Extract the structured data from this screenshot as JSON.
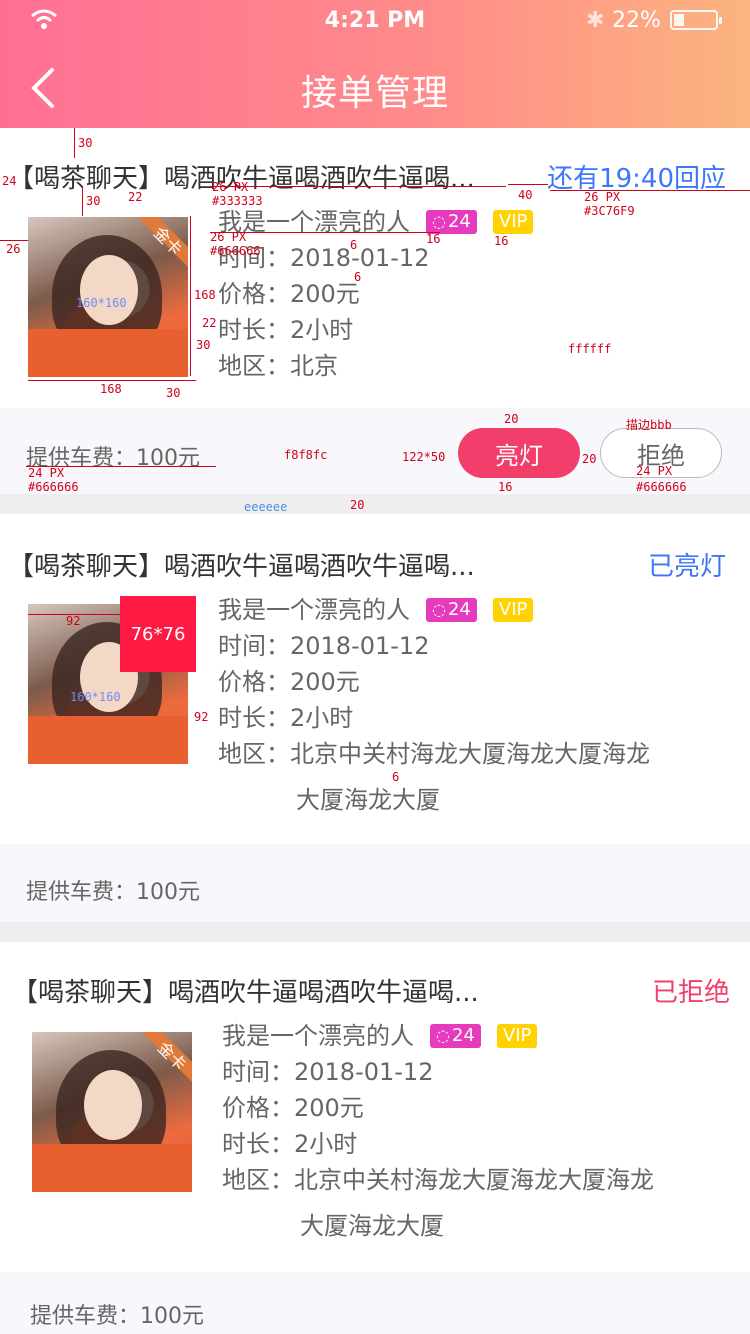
{
  "status_bar": {
    "time": "4:21 PM",
    "battery": "22%",
    "battery_level": 0.22
  },
  "header": {
    "title": "接单管理"
  },
  "orders": [
    {
      "title": "【喝茶聊天】喝酒吹牛逼喝酒吹牛逼喝...",
      "status": "还有19:40回应",
      "status_color": "#3C76F9",
      "badge": "金卡",
      "name": "我是一个漂亮的人",
      "msg_count": "24",
      "vip": "VIP",
      "time": "时间：2018-01-12",
      "price": "价格：200元",
      "duration": "时长：2小时",
      "area": "地区：北京",
      "area_cont": "",
      "fee": "提供车费：100元",
      "btn_light": "亮灯",
      "btn_reject": "拒绝"
    },
    {
      "title": "【喝茶聊天】喝酒吹牛逼喝酒吹牛逼喝...",
      "status": "已亮灯",
      "status_color": "#3C76F9",
      "badge": "76*76",
      "name": "我是一个漂亮的人",
      "msg_count": "24",
      "vip": "VIP",
      "time": "时间：2018-01-12",
      "price": "价格：200元",
      "duration": "时长：2小时",
      "area": "地区：北京中关村海龙大厦海龙大厦海龙",
      "area_cont": "大厦海龙大厦",
      "fee": "提供车费：100元"
    },
    {
      "title": "【喝茶聊天】喝酒吹牛逼喝酒吹牛逼喝...",
      "status": "已拒绝",
      "status_color": "#F23E6A",
      "badge": "金卡",
      "name": "我是一个漂亮的人",
      "msg_count": "24",
      "vip": "VIP",
      "time": "时间：2018-01-12",
      "price": "价格：200元",
      "duration": "时长：2小时",
      "area": "地区：北京中关村海龙大厦海龙大厦海龙",
      "area_cont": "大厦海龙大厦",
      "fee": "提供车费：100元"
    }
  ],
  "annotations": {
    "a30": "30",
    "a24": "24",
    "a30b": "30",
    "a22": "22",
    "a26": "26",
    "a26px": "26 PX",
    "c333": "#333333",
    "a40": "40",
    "a26px2": "26 PX",
    "c3c76f9": "#3C76F9",
    "a26px3": "26 PX",
    "c666": "#666666",
    "a6": "6",
    "a16": "16",
    "a16b": "16",
    "a6b": "6",
    "a168": "168",
    "a22b": "22",
    "a30c": "30",
    "a160": "160*160",
    "a168b": "168",
    "a30d": "30",
    "cffffff": "ffffff",
    "a20": "20",
    "border": "描边bbb",
    "a24px": "24 PX",
    "c666b": "#666666",
    "cf8f8fc": "f8f8fc",
    "a122": "122*50",
    "a20b": "20",
    "a24px2": "24 PX",
    "c666c": "#666666",
    "a16c": "16",
    "ceeeeee": "eeeeee",
    "a20c": "20",
    "a92": "92",
    "a160b": "160*160",
    "a92b": "92",
    "a6c": "6"
  }
}
